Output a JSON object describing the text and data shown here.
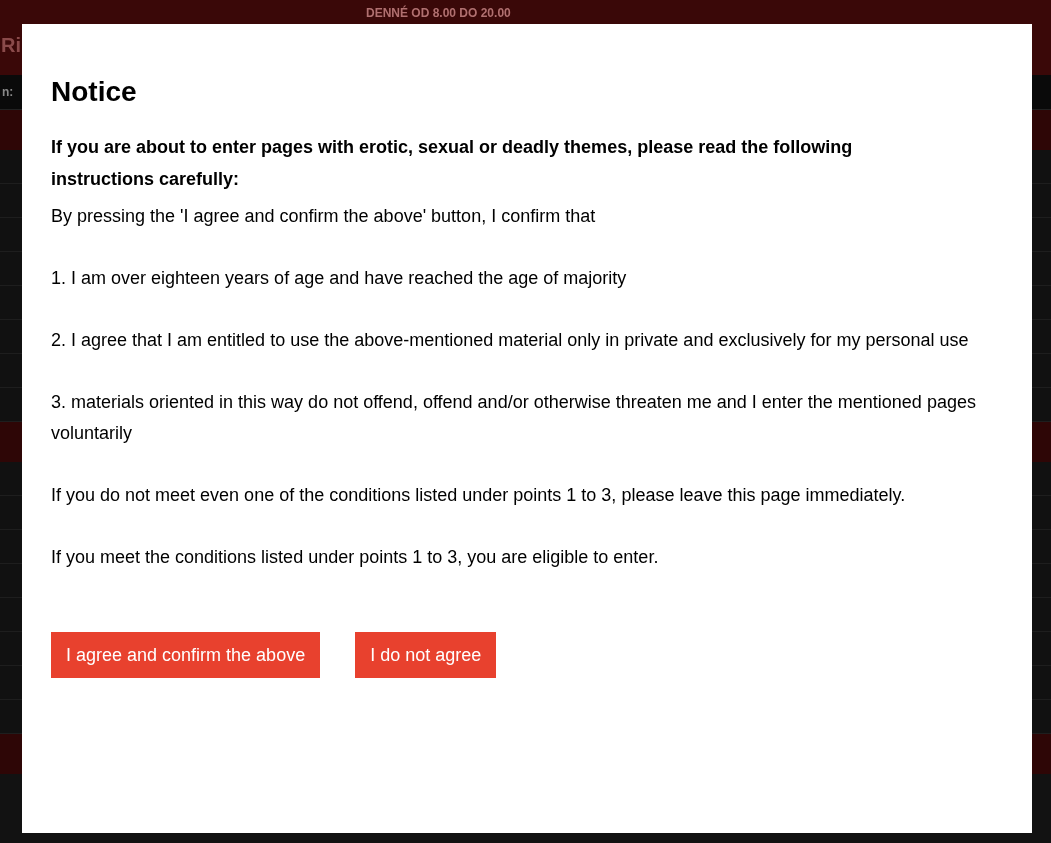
{
  "background": {
    "logo_fragment": "Ri",
    "hours": "DENNÉ OD 8.00 DO 20.00",
    "label_fragment": "n:"
  },
  "dialog": {
    "title": "Notice",
    "intro": "If you are about to enter pages with erotic, sexual or deadly themes, please read the following instructions carefully:",
    "paragraphs": [
      "By pressing the 'I agree and confirm the above' button, I confirm that",
      "1. I am over eighteen years of age and have reached the age of majority",
      "2. I agree that I am entitled to use the above-mentioned material only in private and exclusively for my personal use",
      "3. materials oriented in this way do not offend, offend and/or otherwise threaten me and I enter the mentioned pages voluntarily",
      "If you do not meet even one of the conditions listed under points 1 to 3, please leave this page immediately.",
      "If you meet the conditions listed under points 1 to 3, you are eligible to enter."
    ],
    "buttons": [
      {
        "label": "I agree and confirm the above"
      },
      {
        "label": "I do not agree"
      }
    ]
  }
}
